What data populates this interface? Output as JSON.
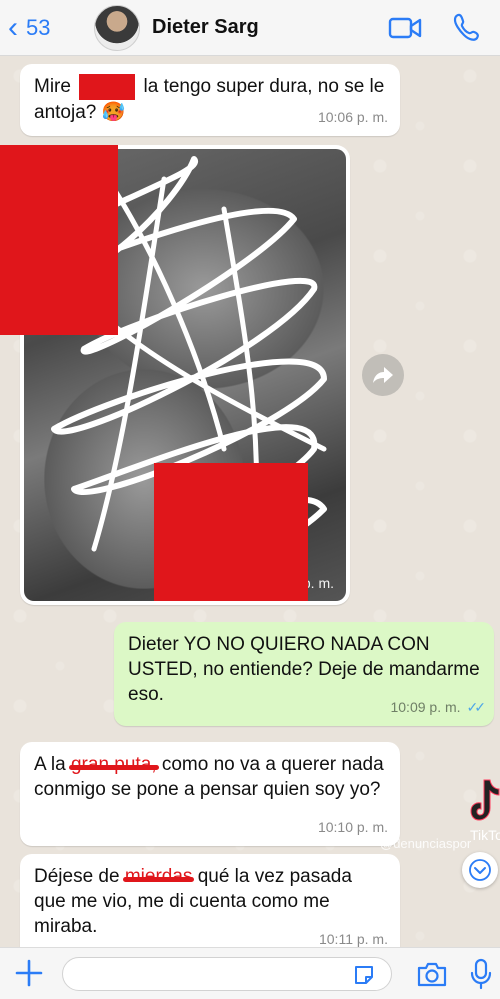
{
  "header": {
    "back_count": "53",
    "contact_name": "Dieter Sarg"
  },
  "messages": [
    {
      "id": "m1",
      "direction": "in",
      "parts": [
        "Mire",
        "la tengo super dura, no se le antoja? 🥵"
      ],
      "time": "10:06 p. m."
    },
    {
      "id": "m2",
      "direction": "in",
      "type": "image",
      "time": "p. m."
    },
    {
      "id": "m3",
      "direction": "out",
      "text": "Dieter YO NO QUIERO NADA CON USTED, no entiende? Deje de mandarme eso.",
      "time": "10:09 p. m.",
      "status": "read"
    },
    {
      "id": "m4",
      "direction": "in",
      "before": "A la",
      "struck": "gran puta,",
      "after": "como no va a querer nada conmigo se pone a pensar quien soy yo?",
      "time": "10:10 p. m."
    },
    {
      "id": "m5",
      "direction": "in",
      "before": "Déjese de",
      "struck": "mierdas",
      "after": "qué la vez pasada que me vio, me di cuenta como me miraba.",
      "time": "10:11 p. m."
    }
  ],
  "overlay": {
    "tiktok_label": "TikTok",
    "watermark": "@denunciaspor"
  },
  "input": {
    "placeholder": ""
  },
  "colors": {
    "accent": "#2b7cf6",
    "outgoing_bubble": "#dcf8c6",
    "incoming_bubble": "#ffffff",
    "redaction": "#e0161b",
    "read_ticks": "#4fa7e8"
  },
  "icons": {
    "back": "chevron-left-icon",
    "video": "video-camera-icon",
    "phone": "phone-icon",
    "forward": "forward-icon",
    "scroll_down": "chevron-down-icon",
    "plus": "plus-icon",
    "sticker": "sticker-icon",
    "camera": "camera-icon",
    "mic": "microphone-icon"
  }
}
